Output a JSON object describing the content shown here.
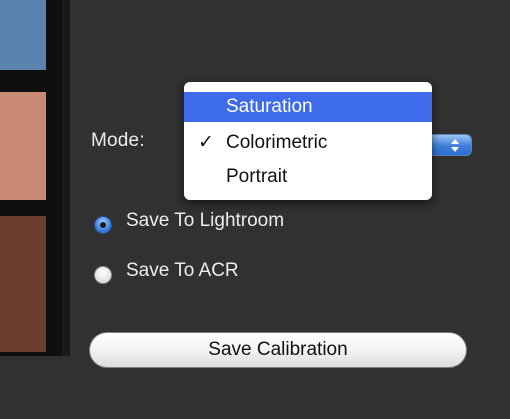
{
  "mode": {
    "label": "Mode:",
    "menu": {
      "items": [
        {
          "label": "Saturation",
          "highlighted": true,
          "checked": false
        },
        {
          "label": "Colorimetric",
          "highlighted": false,
          "checked": true
        },
        {
          "label": "Portrait",
          "highlighted": false,
          "checked": false
        }
      ],
      "check_glyph": "✓"
    },
    "popup_arrows_icon": "updown-arrows-icon"
  },
  "save_target": {
    "options": [
      {
        "label": "Save To Lightroom",
        "selected": true
      },
      {
        "label": "Save To ACR",
        "selected": false
      }
    ]
  },
  "actions": {
    "save_calibration_label": "Save Calibration"
  },
  "colors": {
    "background": "#313131",
    "highlight": "#3d6bea",
    "swatch_blue": "#5a83b0",
    "swatch_peach": "#c98a73",
    "swatch_brown": "#6a3d2e"
  }
}
